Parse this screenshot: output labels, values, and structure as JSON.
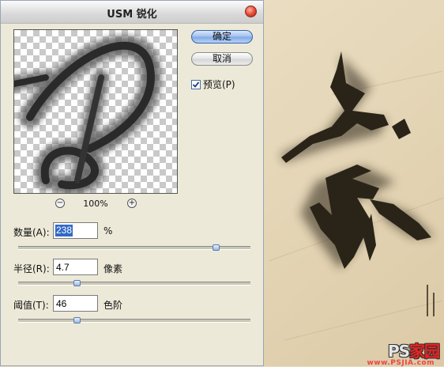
{
  "dialog": {
    "title": "USM 锐化",
    "ok_label": "确定",
    "cancel_label": "取消",
    "preview_label": "预览(P)",
    "preview_checked": true,
    "zoom_out_symbol": "−",
    "zoom_in_symbol": "+",
    "zoom_level": "100%",
    "params": [
      {
        "label": "数量(A):",
        "value": "238",
        "unit": "%",
        "slider_fraction": 0.85
      },
      {
        "label": "半径(R):",
        "value": "4.7",
        "unit": "像素",
        "slider_fraction": 0.25
      },
      {
        "label": "阈值(T):",
        "value": "46",
        "unit": "色阶",
        "slider_fraction": 0.25
      }
    ]
  },
  "background": {
    "watermark_main": "PS",
    "watermark_cn": "家园",
    "watermark_url": "www.PSJIA.com",
    "paper_color": "#e9dcc0",
    "ink_color": "#2a2418"
  },
  "icons": {
    "close": "close-icon",
    "zoom_out": "zoom-out-icon",
    "zoom_in": "zoom-in-icon",
    "check": "checkmark-icon"
  }
}
